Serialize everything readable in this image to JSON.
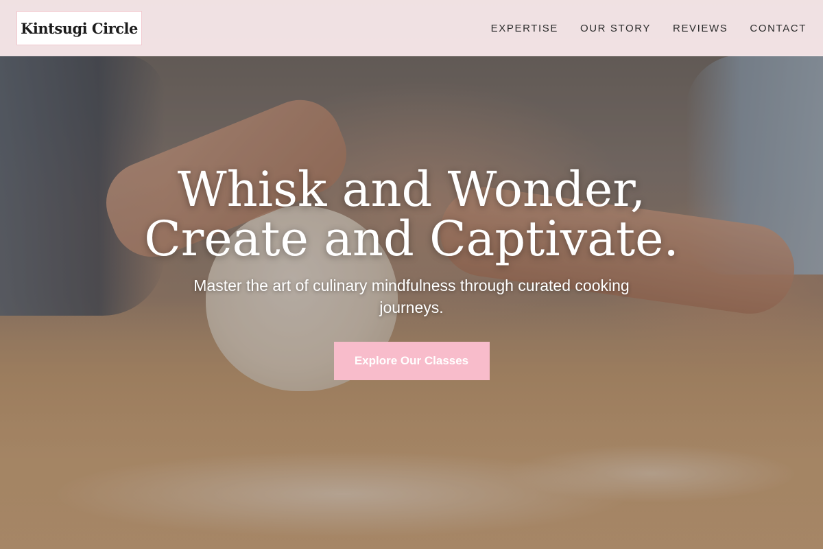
{
  "header": {
    "logo_text": "Kintsugi Circle",
    "nav": [
      {
        "label": "EXPERTISE"
      },
      {
        "label": "OUR STORY"
      },
      {
        "label": "REVIEWS"
      },
      {
        "label": "CONTACT"
      }
    ]
  },
  "hero": {
    "title_line1": "Whisk and Wonder,",
    "title_line2": "Create and Captivate.",
    "subtitle": "Master the art of culinary mindfulness through curated cooking journeys.",
    "cta_label": "Explore Our Classes"
  },
  "colors": {
    "header_bg": "#fcecee",
    "cta_bg": "#f8bccb",
    "text_dark": "#2b2b2b"
  }
}
